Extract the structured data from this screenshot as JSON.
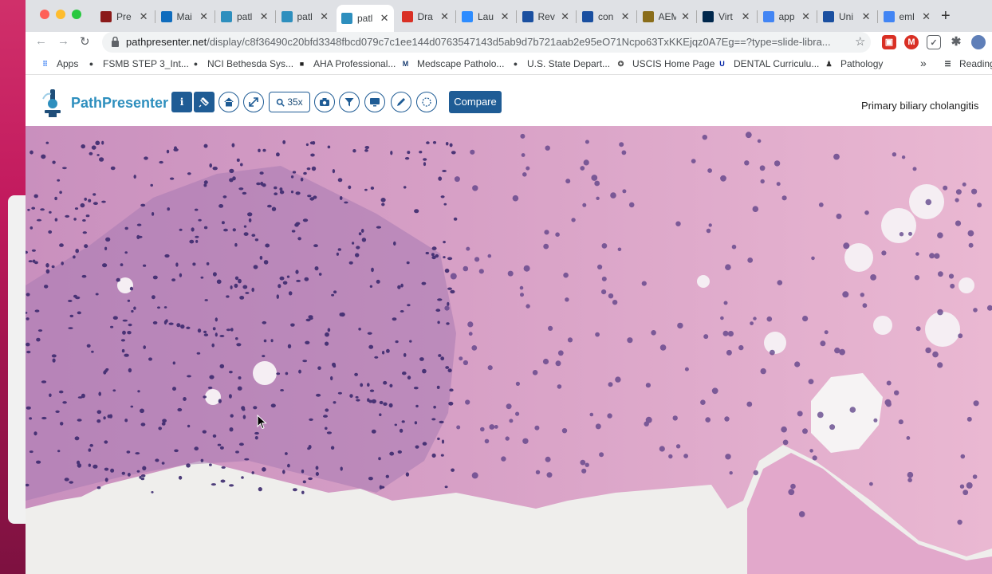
{
  "tabs": [
    {
      "title": "Pre",
      "favicon": "camera-favicon",
      "color": "#8b1a1a",
      "active": false
    },
    {
      "title": "Mai",
      "favicon": "outlook-favicon",
      "color": "#0f6cbd",
      "active": false
    },
    {
      "title": "patl",
      "favicon": "pathpresenter-favicon",
      "color": "#2e8fbe",
      "active": false
    },
    {
      "title": "patl",
      "favicon": "pathpresenter-favicon",
      "color": "#2e8fbe",
      "active": false
    },
    {
      "title": "patl",
      "favicon": "pathpresenter-favicon",
      "color": "#2e8fbe",
      "active": true
    },
    {
      "title": "Dra",
      "favicon": "gmail-favicon",
      "color": "#d93025",
      "active": false
    },
    {
      "title": "Lau",
      "favicon": "zoom-favicon",
      "color": "#2d8cff",
      "active": false
    },
    {
      "title": "Rev",
      "favicon": "n-favicon",
      "color": "#1a4fa0",
      "active": false
    },
    {
      "title": "con",
      "favicon": "n-favicon",
      "color": "#1a4fa0",
      "active": false
    },
    {
      "title": "AEM",
      "favicon": "folder-favicon",
      "color": "#8a6d1a",
      "active": false
    },
    {
      "title": "Virt",
      "favicon": "michigan-favicon",
      "color": "#00274c",
      "active": false
    },
    {
      "title": "app",
      "favicon": "google-favicon",
      "color": "#4285f4",
      "active": false
    },
    {
      "title": "Uni",
      "favicon": "n-favicon",
      "color": "#1a4fa0",
      "active": false
    },
    {
      "title": "eml",
      "favicon": "google-favicon",
      "color": "#4285f4",
      "active": false
    }
  ],
  "address": {
    "host": "pathpresenter.net",
    "path": "/display/c8f36490c20bfd3348fbcd079c7c1ee144d0763547143d5ab9d7b721aab2e95eO71Ncpo63TxKKEjqz0A7Eg==?type=slide-libra..."
  },
  "bookmarks": [
    {
      "label": "Apps",
      "icon": "apps-grid-icon"
    },
    {
      "label": "FSMB STEP 3_Int...",
      "icon": "globe-icon"
    },
    {
      "label": "NCI Bethesda Sys...",
      "icon": "globe-icon"
    },
    {
      "label": "AHA Professional...",
      "icon": "aha-icon"
    },
    {
      "label": "Medscape Patholo...",
      "icon": "medscape-icon"
    },
    {
      "label": "U.S. State Depart...",
      "icon": "globe-icon"
    },
    {
      "label": "USCIS Home Page",
      "icon": "uscis-seal-icon"
    },
    {
      "label": "DENTAL Curriculu...",
      "icon": "uf-icon"
    },
    {
      "label": "Pathology",
      "icon": "microscope-icon"
    }
  ],
  "bookmarks_overflow": "»",
  "reading_list": "Reading",
  "app": {
    "brand": "PathPresenter",
    "zoom_label": "35x",
    "compare_label": "Compare",
    "slide_title": "Primary biliary cholangitis",
    "toolbar_icons": [
      "info-icon",
      "pin-icon",
      "home-icon",
      "expand-icon",
      "zoom-icon",
      "camera-icon",
      "filter-icon",
      "monitor-icon",
      "pencil-icon",
      "circle-select-icon"
    ]
  },
  "colors": {
    "brand": "#2e8fbe",
    "toolbar_blue": "#1f5c95",
    "tissue_pink": "#e2a2c4",
    "nuclei_purple": "#3c2a6e"
  }
}
